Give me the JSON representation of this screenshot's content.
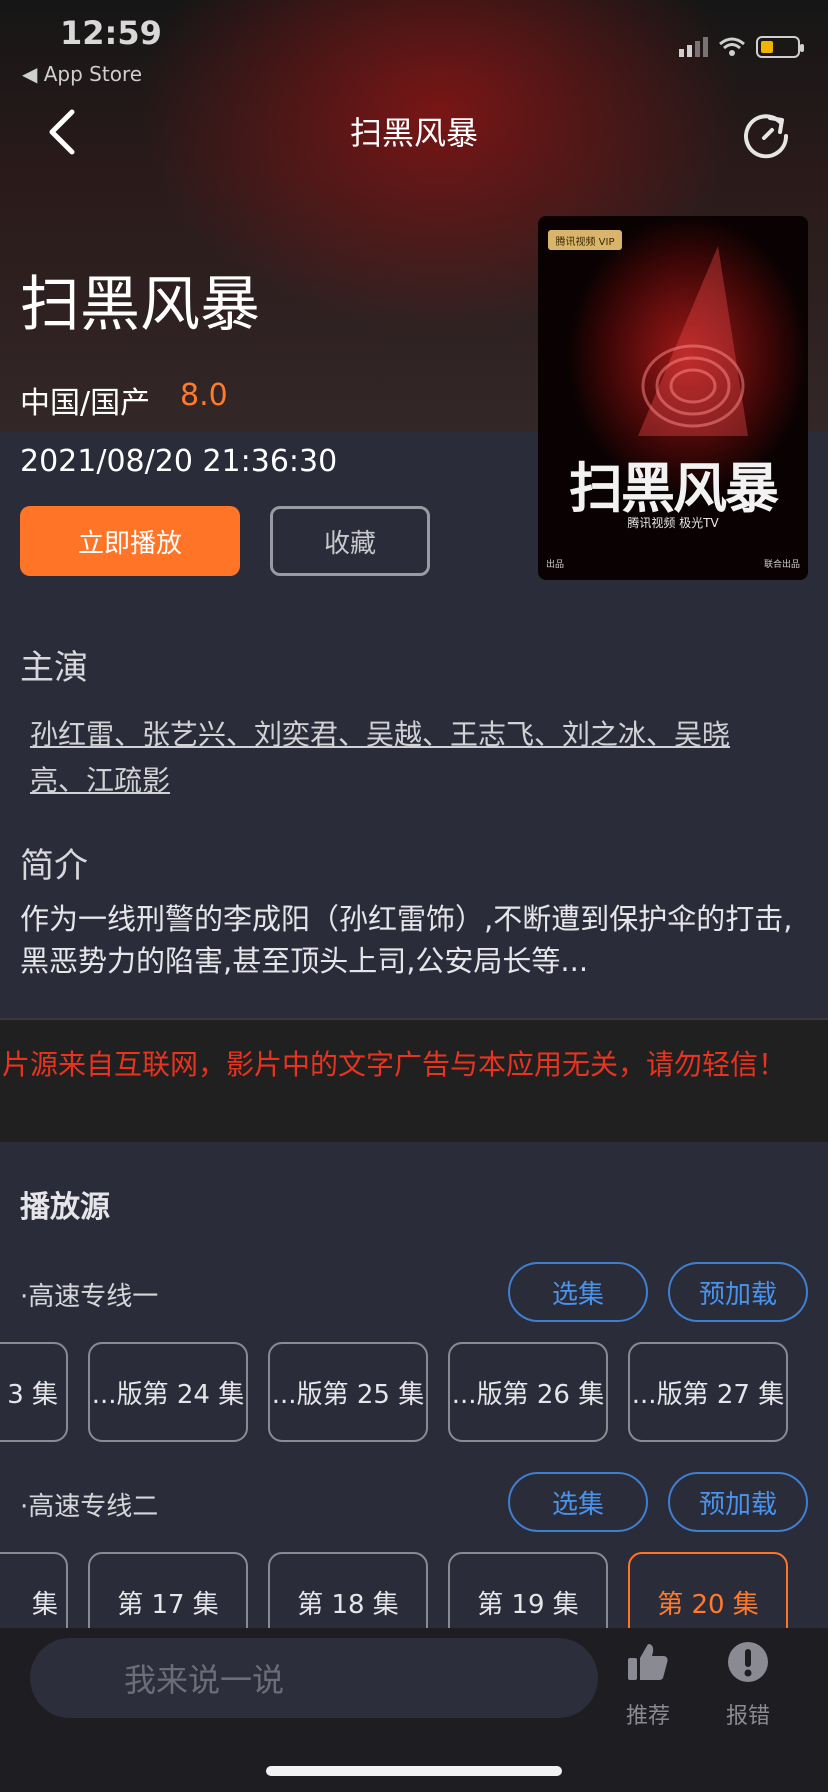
{
  "status_bar": {
    "time": "12:59",
    "back_app": "◀ App Store"
  },
  "nav": {
    "title": "扫黑风暴"
  },
  "movie": {
    "title": "扫黑风暴",
    "region": "中国/国产",
    "score": "8.0",
    "date": "2021/08/20 21:36:30",
    "play_label": "立即播放",
    "favorite_label": "收藏"
  },
  "poster": {
    "vip_badge": "腾讯视频 VIP",
    "title_text": "扫黑风暴",
    "subtitle": "腾讯视频   极光TV",
    "footer_left": "出品",
    "footer_right": "联合出品"
  },
  "cast": {
    "heading": "主演",
    "text": "孙红雷、张艺兴、刘奕君、吴越、王志飞、刘之冰、吴晓亮、江疏影"
  },
  "intro": {
    "heading": "简介",
    "text": "作为一线刑警的李成阳（孙红雷饰）,不断遭到保护伞的打击,黑恶势力的陷害,甚至顶头上司,公安局长等..."
  },
  "notice": "片源来自互联网，影片中的文字广告与本应用无关，请勿轻信！",
  "sources": {
    "heading": "播放源",
    "lines": [
      {
        "label": "·高速专线一",
        "select_label": "选集",
        "preload_label": "预加载",
        "episodes": [
          "3 集",
          "...版第 24 集",
          "...版第 25 集",
          "...版第 26 集",
          "...版第 27 集"
        ]
      },
      {
        "label": "·高速专线二",
        "select_label": "选集",
        "preload_label": "预加载",
        "episodes": [
          "集",
          "第 17 集",
          "第 18 集",
          "第 19 集",
          "第 20 集"
        ]
      }
    ]
  },
  "bottom": {
    "comment_placeholder": "我来说一说",
    "recommend_label": "推荐",
    "report_label": "报错"
  },
  "colors": {
    "accent": "#ff7426",
    "link_blue": "#4a93ea",
    "warning_red": "#e8331f",
    "background": "#2b2c3a"
  }
}
